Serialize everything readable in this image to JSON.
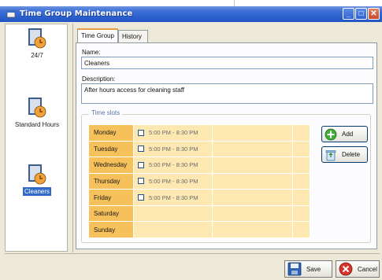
{
  "window": {
    "title": "Time Group Maintenance",
    "min_glyph": "_",
    "max_glyph": "□",
    "close_glyph": "✕"
  },
  "groups": [
    {
      "label": "24/7",
      "selected": false
    },
    {
      "label": "Standard Hours",
      "selected": false
    },
    {
      "label": "Cleaners",
      "selected": true
    }
  ],
  "tabs": [
    {
      "label": "Time Group",
      "active": true
    },
    {
      "label": "History",
      "active": false
    }
  ],
  "form": {
    "name_label": "Name:",
    "name_value": "Cleaners",
    "description_label": "Description:",
    "description_value": "After hours access for cleaning staff"
  },
  "time_slots": {
    "legend": "Time slots",
    "days": [
      {
        "day": "Monday",
        "slot": "5:00 PM - 8:30 PM"
      },
      {
        "day": "Tuesday",
        "slot": "5:00 PM - 8:30 PM"
      },
      {
        "day": "Wednesday",
        "slot": "5:00 PM - 8:30 PM"
      },
      {
        "day": "Thursday",
        "slot": "5:00 PM - 8:30 PM"
      },
      {
        "day": "Friday",
        "slot": "5:00 PM - 8:30 PM"
      },
      {
        "day": "Saturday",
        "slot": ""
      },
      {
        "day": "Sunday",
        "slot": ""
      }
    ],
    "add_label": "Add",
    "delete_label": "Delete"
  },
  "footer": {
    "save_label": "Save",
    "cancel_label": "Cancel"
  },
  "colors": {
    "titlebar": "#2a5fcc",
    "day_cell": "#f6c05a",
    "slot_cell": "#fde8b2",
    "selection": "#316ac5"
  }
}
